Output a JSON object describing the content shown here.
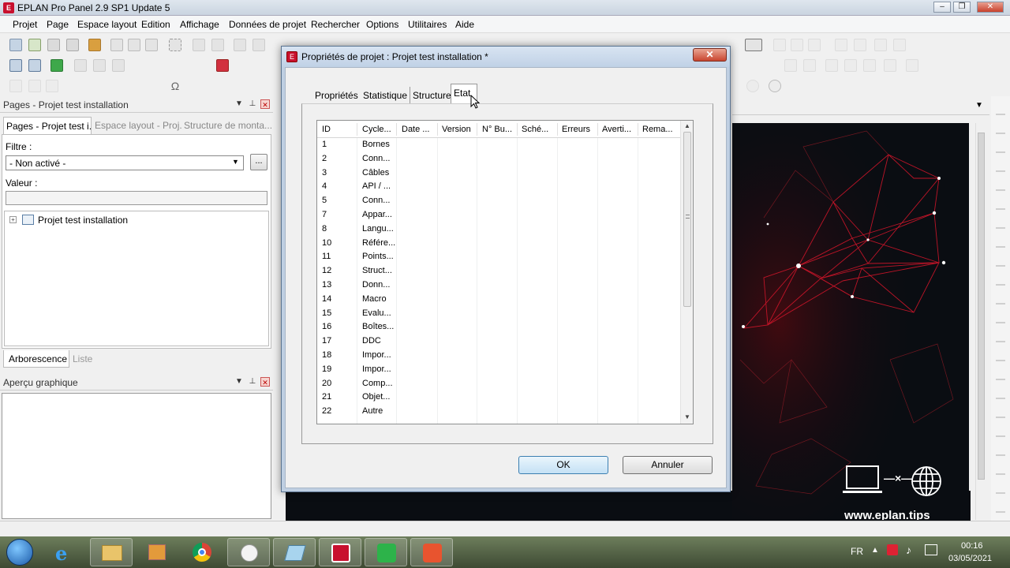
{
  "window": {
    "title": "EPLAN Pro Panel 2.9 SP1 Update 5",
    "controls": {
      "minimize": "–",
      "maximize": "❐",
      "close": "✕"
    }
  },
  "menu": [
    "Projet",
    "Page",
    "Espace layout",
    "Edition",
    "Affichage",
    "Données de projet",
    "Rechercher",
    "Options",
    "Utilitaires",
    "Aide"
  ],
  "left_panel": {
    "header": "Pages - Projet test installation",
    "tabs": [
      "Pages - Projet test i...",
      "Espace layout - Proj...",
      "Structure de monta..."
    ],
    "filter_label": "Filtre :",
    "filter_value": "- Non activé -",
    "filter_more": "...",
    "value_label": "Valeur :",
    "value_input": "",
    "tree_root": "Projet test installation",
    "bottom_tabs": [
      "Arborescence",
      "Liste"
    ],
    "preview_header": "Aperçu graphique"
  },
  "dialog": {
    "title": "Propriétés de projet : Projet test installation *",
    "close": "✕",
    "tabs": [
      "Propriétés",
      "Statistique",
      "Structure",
      "Etat"
    ],
    "active_tab": "Etat",
    "columns": [
      "ID",
      "Cycle...",
      "Date ...",
      "Version",
      "N° Bu...",
      "Sché...",
      "Erreurs",
      "Averti...",
      "Rema..."
    ],
    "rows": [
      [
        "1",
        "Bornes"
      ],
      [
        "2",
        "Conn..."
      ],
      [
        "3",
        "Câbles"
      ],
      [
        "4",
        "API / ..."
      ],
      [
        "5",
        "Conn..."
      ],
      [
        "7",
        "Appar..."
      ],
      [
        "8",
        "Langu..."
      ],
      [
        "10",
        "Référe..."
      ],
      [
        "11",
        "Points..."
      ],
      [
        "12",
        "Struct..."
      ],
      [
        "13",
        "Donn..."
      ],
      [
        "14",
        "Macro"
      ],
      [
        "15",
        "Evalu..."
      ],
      [
        "16",
        "Boîtes..."
      ],
      [
        "17",
        "DDC"
      ],
      [
        "18",
        "Impor..."
      ],
      [
        "19",
        "Impor..."
      ],
      [
        "20",
        "Comp..."
      ],
      [
        "21",
        "Objet..."
      ],
      [
        "22",
        "Autre"
      ]
    ],
    "ok": "OK",
    "cancel": "Annuler"
  },
  "brand": {
    "url": "www.eplan.tips",
    "symbol": "—×—"
  },
  "taskbar": {
    "lang": "FR",
    "time": "00:16",
    "date": "03/05/2021"
  },
  "colors": {
    "eplan_red": "#c8102e",
    "graphic_bg": "#0a0d12",
    "graphic_lines": "#d0152a"
  },
  "icons": [
    "start-orb-icon",
    "ie-icon",
    "explorer-icon",
    "media-icon",
    "chrome-icon",
    "paint-icon",
    "app-icon",
    "eplan-icon",
    "camtasia-green-icon",
    "camtasia-red-icon"
  ]
}
